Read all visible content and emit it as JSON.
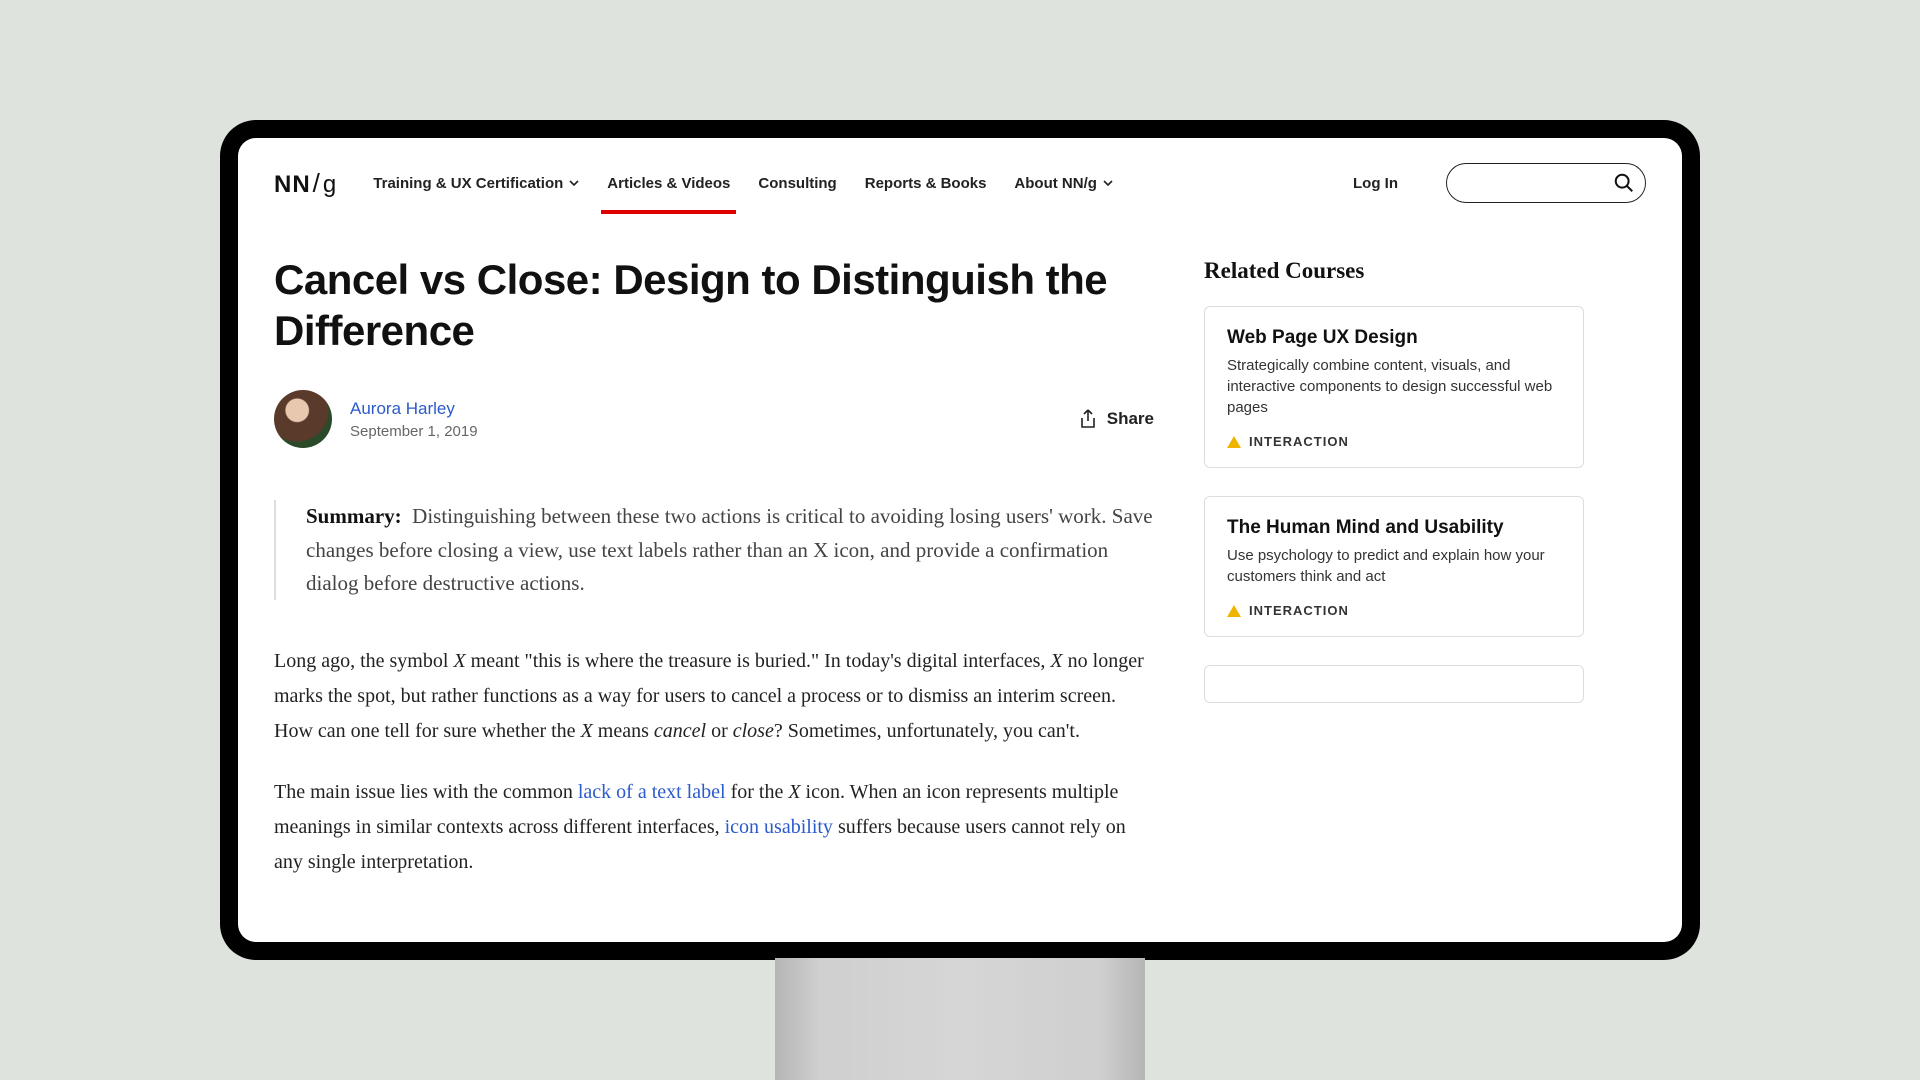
{
  "logo": {
    "part1": "NN",
    "part2": "g"
  },
  "nav": {
    "items": [
      {
        "label": "Training & UX Certification",
        "dropdown": true,
        "active": false
      },
      {
        "label": "Articles & Videos",
        "dropdown": false,
        "active": true
      },
      {
        "label": "Consulting",
        "dropdown": false,
        "active": false
      },
      {
        "label": "Reports & Books",
        "dropdown": false,
        "active": false
      },
      {
        "label": "About NN/g",
        "dropdown": true,
        "active": false
      }
    ],
    "login": "Log In"
  },
  "article": {
    "title": "Cancel vs Close: Design to Distinguish the Difference",
    "author": "Aurora Harley",
    "date": "September 1, 2019",
    "share_label": "Share",
    "summary_label": "Summary:",
    "summary_text": "Distinguishing between these two actions is critical to avoiding losing users' work. Save changes before closing a view, use text labels rather than an X icon, and provide a confirmation dialog before destructive actions.",
    "p1_a": "Long ago, the symbol ",
    "p1_x1": "X",
    "p1_b": " meant \"this is where the treasure is buried.\" In today's digital interfaces, ",
    "p1_x2": "X",
    "p1_c": " no longer marks the spot, but rather functions as a way for users to cancel a process or to dismiss an interim screen. How can one tell for sure whether the ",
    "p1_x3": "X",
    "p1_d": " means ",
    "p1_cancel": "cancel",
    "p1_e": " or ",
    "p1_close": "close",
    "p1_f": "? Sometimes, unfortunately, you can't.",
    "p2_a": "The main issue lies with the common ",
    "p2_link1": "lack of a text label",
    "p2_b": " for the ",
    "p2_x": "X",
    "p2_c": " icon. When an icon represents multiple meanings in similar contexts across different interfaces, ",
    "p2_link2": "icon usability",
    "p2_d": " suffers because users cannot rely on any single interpretation."
  },
  "sidebar": {
    "heading": "Related Courses",
    "courses": [
      {
        "title": "Web Page UX Design",
        "desc": "Strategically combine content, visuals, and interactive components to design successful web pages",
        "tag": "INTERACTION"
      },
      {
        "title": "The Human Mind and Usability",
        "desc": "Use psychology to predict and explain how your customers think and act",
        "tag": "INTERACTION"
      }
    ]
  }
}
